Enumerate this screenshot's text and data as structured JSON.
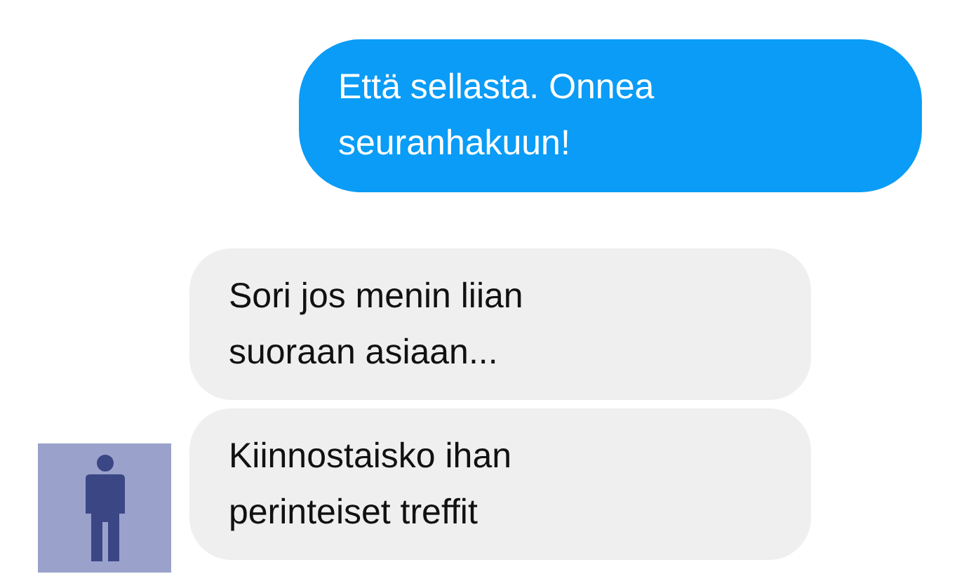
{
  "messages": [
    {
      "kind": "sent",
      "text": "Että sellasta. Onnea seuranhakuun!"
    },
    {
      "kind": "received",
      "text": "Sori jos menin liian suoraan asiaan..."
    },
    {
      "kind": "received",
      "text": "Kiinnostaisko ihan perinteiset treffit",
      "show_avatar": true
    }
  ]
}
